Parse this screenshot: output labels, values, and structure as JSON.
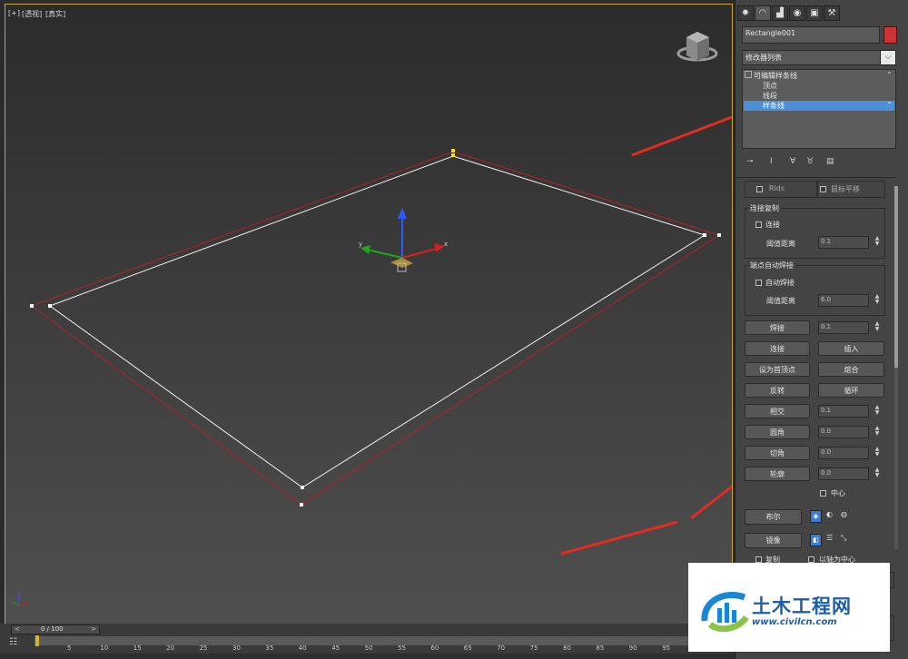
{
  "viewport": {
    "label_plus": "[+]",
    "label_view": "[透视]",
    "label_shading": "[真实]",
    "axis_x": "x",
    "axis_y": "y",
    "axis_z": "z"
  },
  "panel": {
    "tabs": [
      "create-icon",
      "modify-icon",
      "hierarchy-icon",
      "motion-icon",
      "display-icon",
      "utilities-icon"
    ],
    "object_name": "Rectangle001",
    "object_color": "#cc3333",
    "modifier_list": "修改器列表",
    "stack": {
      "root": "可编辑样条线",
      "items": [
        "顶点",
        "线段",
        "样条线"
      ],
      "selected_index": 2
    },
    "partial_row": {
      "left": "Rids",
      "right": "鼠标平移"
    },
    "connect_copy": {
      "title": "连接复制",
      "checkbox_label": "连接",
      "threshold_label": "阈值距离",
      "threshold_value": "0.1"
    },
    "end_auto_weld": {
      "title": "端点自动焊接",
      "checkbox_label": "自动焊接",
      "threshold_label": "阈值距离",
      "threshold_value": "6.0"
    },
    "buttons": {
      "weld": "焊接",
      "weld_value": "0.1",
      "connect": "连接",
      "insert": "插入",
      "make_first": "设为首顶点",
      "fuse": "熔合",
      "reverse": "反转",
      "cycle": "循环",
      "cross_insert": "相交",
      "cross_value": "0.1",
      "fillet": "圆角",
      "fillet_value": "0.0",
      "chamfer": "切角",
      "chamfer_value": "0.0",
      "outline": "轮廓",
      "outline_value": "0.0",
      "center": "中心",
      "boolean": "布尔",
      "mirror": "镜像",
      "copy": "复制",
      "about_pivot": "以轴为中心"
    }
  },
  "timeline": {
    "frame_counter": "0 / 100",
    "prev": "<",
    "next": ">",
    "ticks": [
      "5",
      "10",
      "15",
      "20",
      "25",
      "30",
      "35",
      "40",
      "45",
      "50",
      "55",
      "60",
      "65",
      "70",
      "75",
      "80",
      "85",
      "90",
      "95"
    ]
  },
  "watermark": {
    "title": "土木工程网",
    "url": "www.civilcn.com"
  }
}
